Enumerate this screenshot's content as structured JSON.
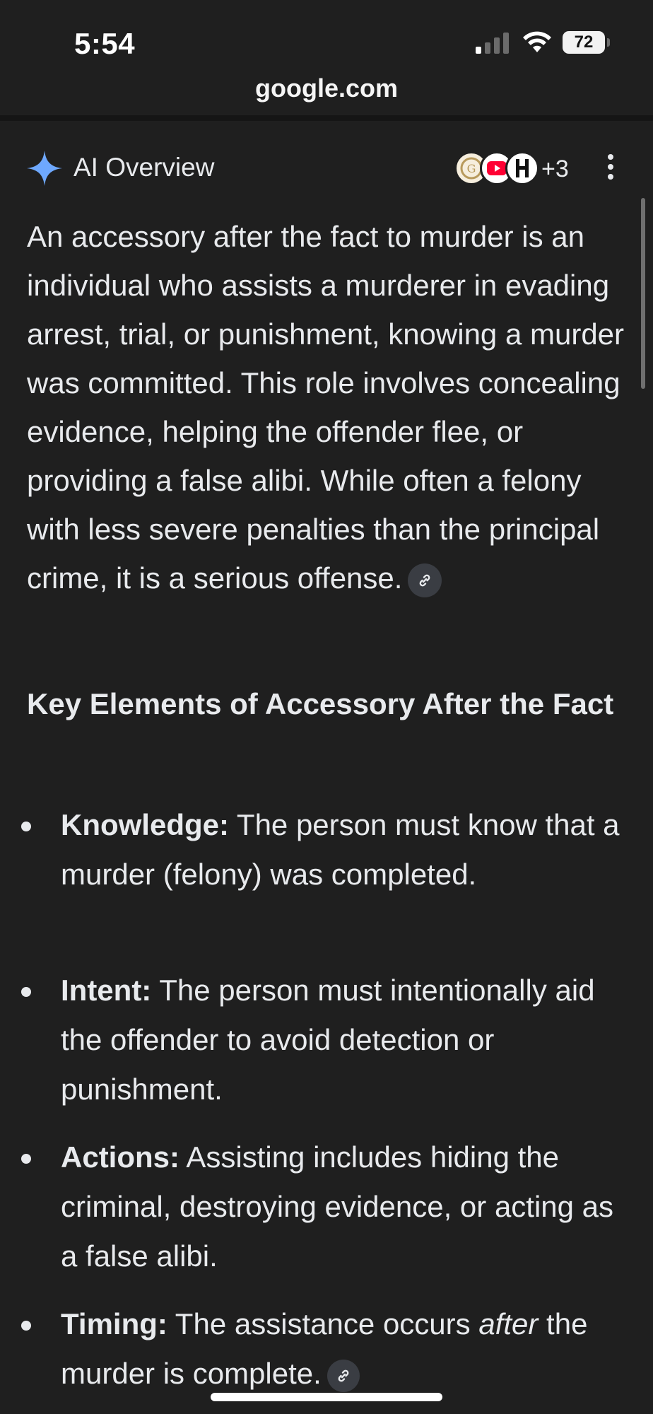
{
  "status_bar": {
    "time": "5:54",
    "battery": "72"
  },
  "url": "google.com",
  "ai_overview": {
    "title": "AI Overview",
    "more_sources": "+3",
    "paragraph": "An accessory after the fact to murder is an individual who assists a murderer in evading arrest, trial, or punishment, knowing a murder was committed. This role involves concealing evidence, helping the offender flee, or providing a false alibi. While often a felony with less severe penalties than the principal crime, it is a serious offense.",
    "heading": "Key Elements of Accessory After the Fact",
    "bullets": [
      {
        "term": "Knowledge:",
        "text": " The person must know that a murder (felony) was completed."
      },
      {
        "term": "Intent:",
        "text": " The person must intentionally aid the offender to avoid detection or punishment."
      },
      {
        "term": "Actions:",
        "text": " Assisting includes hiding the criminal, destroying evidence, or acting as a false alibi."
      },
      {
        "term": "Timing:",
        "text_before": " The assistance occurs ",
        "emphasis": "after",
        "text_after": " the murder is complete."
      }
    ]
  },
  "colors": {
    "background": "#1f1f1f",
    "text": "#e8eaed",
    "spark_blue": "#6ea8fe",
    "youtube_red": "#ff0033"
  }
}
